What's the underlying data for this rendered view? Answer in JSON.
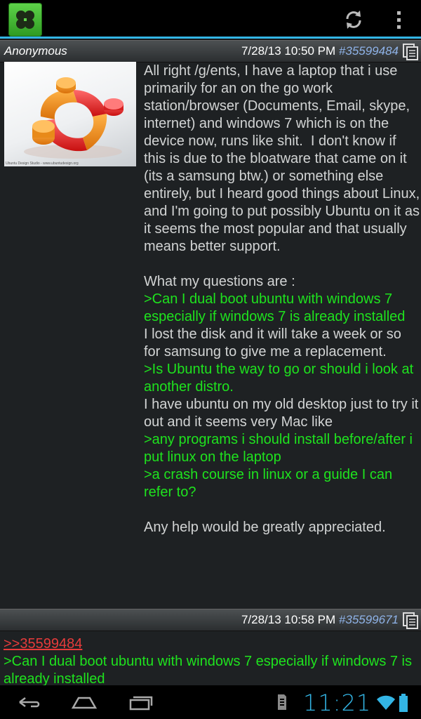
{
  "app": {
    "logo_icon": "clover-icon",
    "accent": "#33b5e5"
  },
  "toolbar": {
    "refresh_icon": "refresh-icon",
    "overflow_icon": "overflow-menu-icon"
  },
  "posts": [
    {
      "name": "Anonymous",
      "datetime": "7/28/13 10:50 PM",
      "number": "#35599484",
      "thumbnail": {
        "icon": "ubuntu-logo-3d-image",
        "caption": "Ubuntu Design Studio - www.ubuntudesign.org"
      },
      "lines": [
        {
          "type": "text",
          "text": "All right /g/ents, I have a laptop that i use primarily for an on the go work station/browser (Documents, Email, skype, internet) and windows 7 which is on the device now, runs like shit.  I don't know if this is due to the bloatware that came on it (its a samsung btw.) or something else entirely, but I heard good things about Linux, and I'm going to put possibly Ubuntu on it as it seems the most popular and that usually means better support."
        },
        {
          "type": "blank",
          "text": ""
        },
        {
          "type": "text",
          "text": "What my questions are :"
        },
        {
          "type": "quote",
          "text": ">Can I dual boot ubuntu with windows 7 especially if windows 7 is already installed"
        },
        {
          "type": "text",
          "text": "I lost the disk and it will take a week or so for samsung to give me a replacement."
        },
        {
          "type": "quote",
          "text": ">Is Ubuntu the way to go or should i look at another distro."
        },
        {
          "type": "text",
          "text": "I have ubuntu on my old desktop just to try it out and it seems very Mac like"
        },
        {
          "type": "quote",
          "text": ">any programs i should install before/after i put linux on the laptop"
        },
        {
          "type": "quote",
          "text": ">a crash course in linux or a guide I can refer to?"
        },
        {
          "type": "blank",
          "text": ""
        },
        {
          "type": "text",
          "text": "Any help would be greatly appreciated."
        }
      ]
    },
    {
      "name": "",
      "datetime": "7/28/13 10:58 PM",
      "number": "#35599671",
      "reply_link": ">>35599484",
      "lines": [
        {
          "type": "quote",
          "text": ">Can I dual boot ubuntu with windows 7 especially if windows 7 is already installed"
        }
      ]
    }
  ],
  "navbar": {
    "back_icon": "back-icon",
    "home_icon": "home-icon",
    "recents_icon": "recent-apps-icon",
    "clock": "11:21",
    "colors": {
      "clock": "#33b5e5",
      "quote": "#1ee31e",
      "reply_link": "#e63b3b",
      "post_number": "#8fb3e8"
    }
  }
}
